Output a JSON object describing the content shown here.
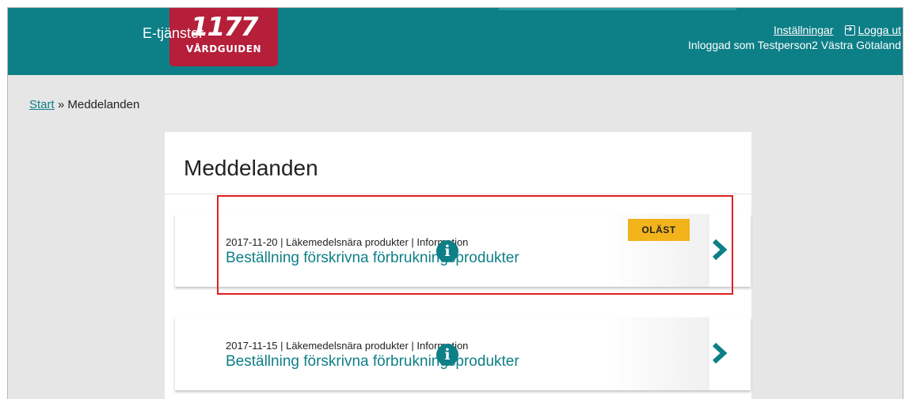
{
  "header": {
    "service_name": "E-tjänster",
    "logo": {
      "number": "1177",
      "subtitle": "VÅRDGUIDEN"
    },
    "settings_label": "Inställningar",
    "logout_label": "Logga ut",
    "logged_in_text": "Inloggad som Testperson2 Västra Götaland"
  },
  "breadcrumb": {
    "start": "Start",
    "separator": "»",
    "current": "Meddelanden"
  },
  "panel": {
    "title": "Meddelanden",
    "messages": [
      {
        "meta": "2017-11-20 | Läkemedelsnära produkter | Information",
        "subject": "Beställning förskrivna förbrukningsprodukter",
        "badge": "OLÄST"
      },
      {
        "meta": "2017-11-15 | Läkemedelsnära produkter | Information",
        "subject": "Beställning förskrivna förbrukningsprodukter"
      }
    ]
  },
  "colors": {
    "brand_teal": "#0d7f87",
    "logo_red": "#b51f3a",
    "badge_yellow": "#f3b31b",
    "highlight_red": "#e02020"
  },
  "icons": [
    "logout-icon",
    "info-icon",
    "chevron-right-icon"
  ]
}
